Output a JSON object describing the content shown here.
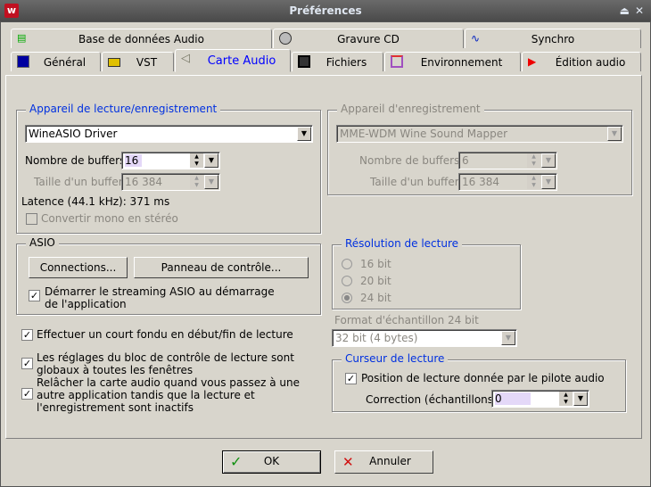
{
  "window": {
    "title": "Préférences"
  },
  "tabs_row1": [
    {
      "label": "Base de données Audio",
      "icon": "database-icon"
    },
    {
      "label": "Gravure CD",
      "icon": "cd-icon"
    },
    {
      "label": "Synchro",
      "icon": "sync-wave-icon"
    }
  ],
  "tabs_row2": [
    {
      "label": "Général",
      "icon": "computer-icon"
    },
    {
      "label": "VST",
      "icon": "vst-icon"
    },
    {
      "label": "Carte Audio",
      "icon": "speaker-icon"
    },
    {
      "label": "Fichiers",
      "icon": "floppy-icon"
    },
    {
      "label": "Environnement",
      "icon": "environment-icon"
    },
    {
      "label": "Édition audio",
      "icon": "audio-edit-icon"
    }
  ],
  "playback": {
    "legend": "Appareil de lecture/enregistrement",
    "device": "WineASIO Driver",
    "buffers_label": "Nombre de buffers",
    "buffers_value": "16",
    "size_label": "Taille d'un buffer",
    "size_value": "16 384",
    "latency": "Latence (44.1 kHz): 371 ms",
    "mono_label": "Convertir mono en stéréo"
  },
  "record": {
    "legend": "Appareil d'enregistrement",
    "device": "MME-WDM Wine Sound Mapper",
    "buffers_label": "Nombre de buffers",
    "buffers_value": "6",
    "size_label": "Taille d'un buffer",
    "size_value": "16 384"
  },
  "asio": {
    "legend": "ASIO",
    "connections": "Connections...",
    "control_panel": "Panneau de contrôle...",
    "start_label": "Démarrer le streaming ASIO au démarrage de l'application"
  },
  "options": [
    "Effectuer un court fondu en début/fin de lecture",
    "Les réglages du bloc de contrôle de lecture sont globaux à toutes les fenêtres",
    "Relâcher la carte audio quand vous passez à une autre application tandis que la lecture et l'enregistrement sont inactifs"
  ],
  "resolution": {
    "legend": "Résolution de lecture",
    "options": [
      "16 bit",
      "20 bit",
      "24 bit"
    ],
    "selected": "24 bit"
  },
  "format": {
    "label": "Format d'échantillon 24 bit",
    "value": "32 bit (4 bytes)"
  },
  "cursor": {
    "legend": "Curseur de lecture",
    "driver_label": "Position de lecture donnée par le pilote audio",
    "correction_label": "Correction (échantillons)",
    "correction_value": "0"
  },
  "buttons": {
    "ok": "OK",
    "cancel": "Annuler"
  }
}
